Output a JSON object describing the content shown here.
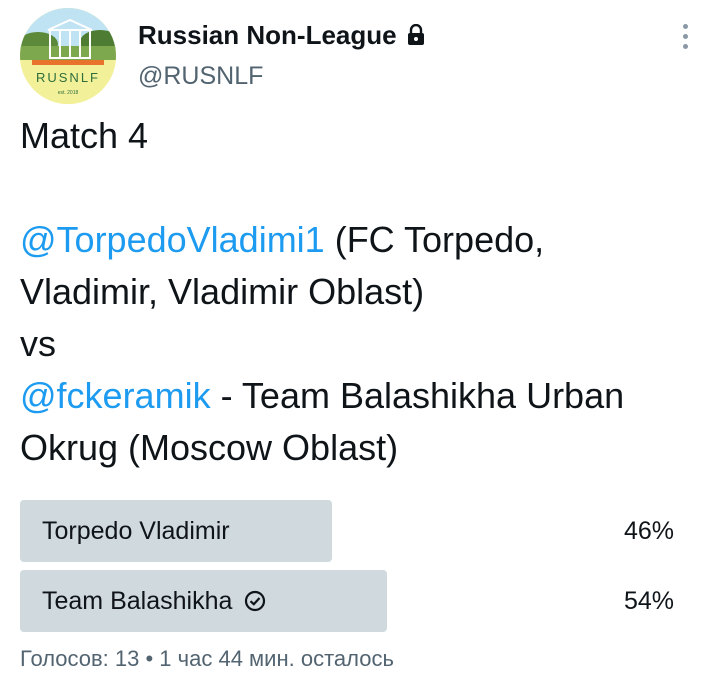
{
  "author": {
    "display_name": "Russian Non-League",
    "handle": "@RUSNLF",
    "avatar_text": "RUSNLF",
    "avatar_sub": "est. 2018"
  },
  "tweet": {
    "line1": "Match 4",
    "mention1": "@TorpedoVladimi1",
    "team1_rest": " (FC Torpedo,",
    "team1_line2": "Vladimir, Vladimir Oblast)",
    "vs": "vs",
    "mention2": "@fckeramik",
    "team2_rest": " - Team Balashikha Urban",
    "team2_line2": "Okrug (Moscow Oblast)"
  },
  "poll": {
    "options": [
      {
        "label": "Torpedo Vladimir",
        "percent_text": "46%",
        "percent": 46,
        "selected": false
      },
      {
        "label": "Team Balashikha",
        "percent_text": "54%",
        "percent": 54,
        "selected": true
      }
    ],
    "meta": "Голосов: 13 • 1 час 44 мин. осталось"
  },
  "icons": {
    "lock": "lock-icon",
    "more": "more-options-icon",
    "check": "check-circle-icon"
  },
  "colors": {
    "link": "#1d9bf0",
    "poll_bar": "#cfd9de",
    "secondary_text": "#536471"
  }
}
